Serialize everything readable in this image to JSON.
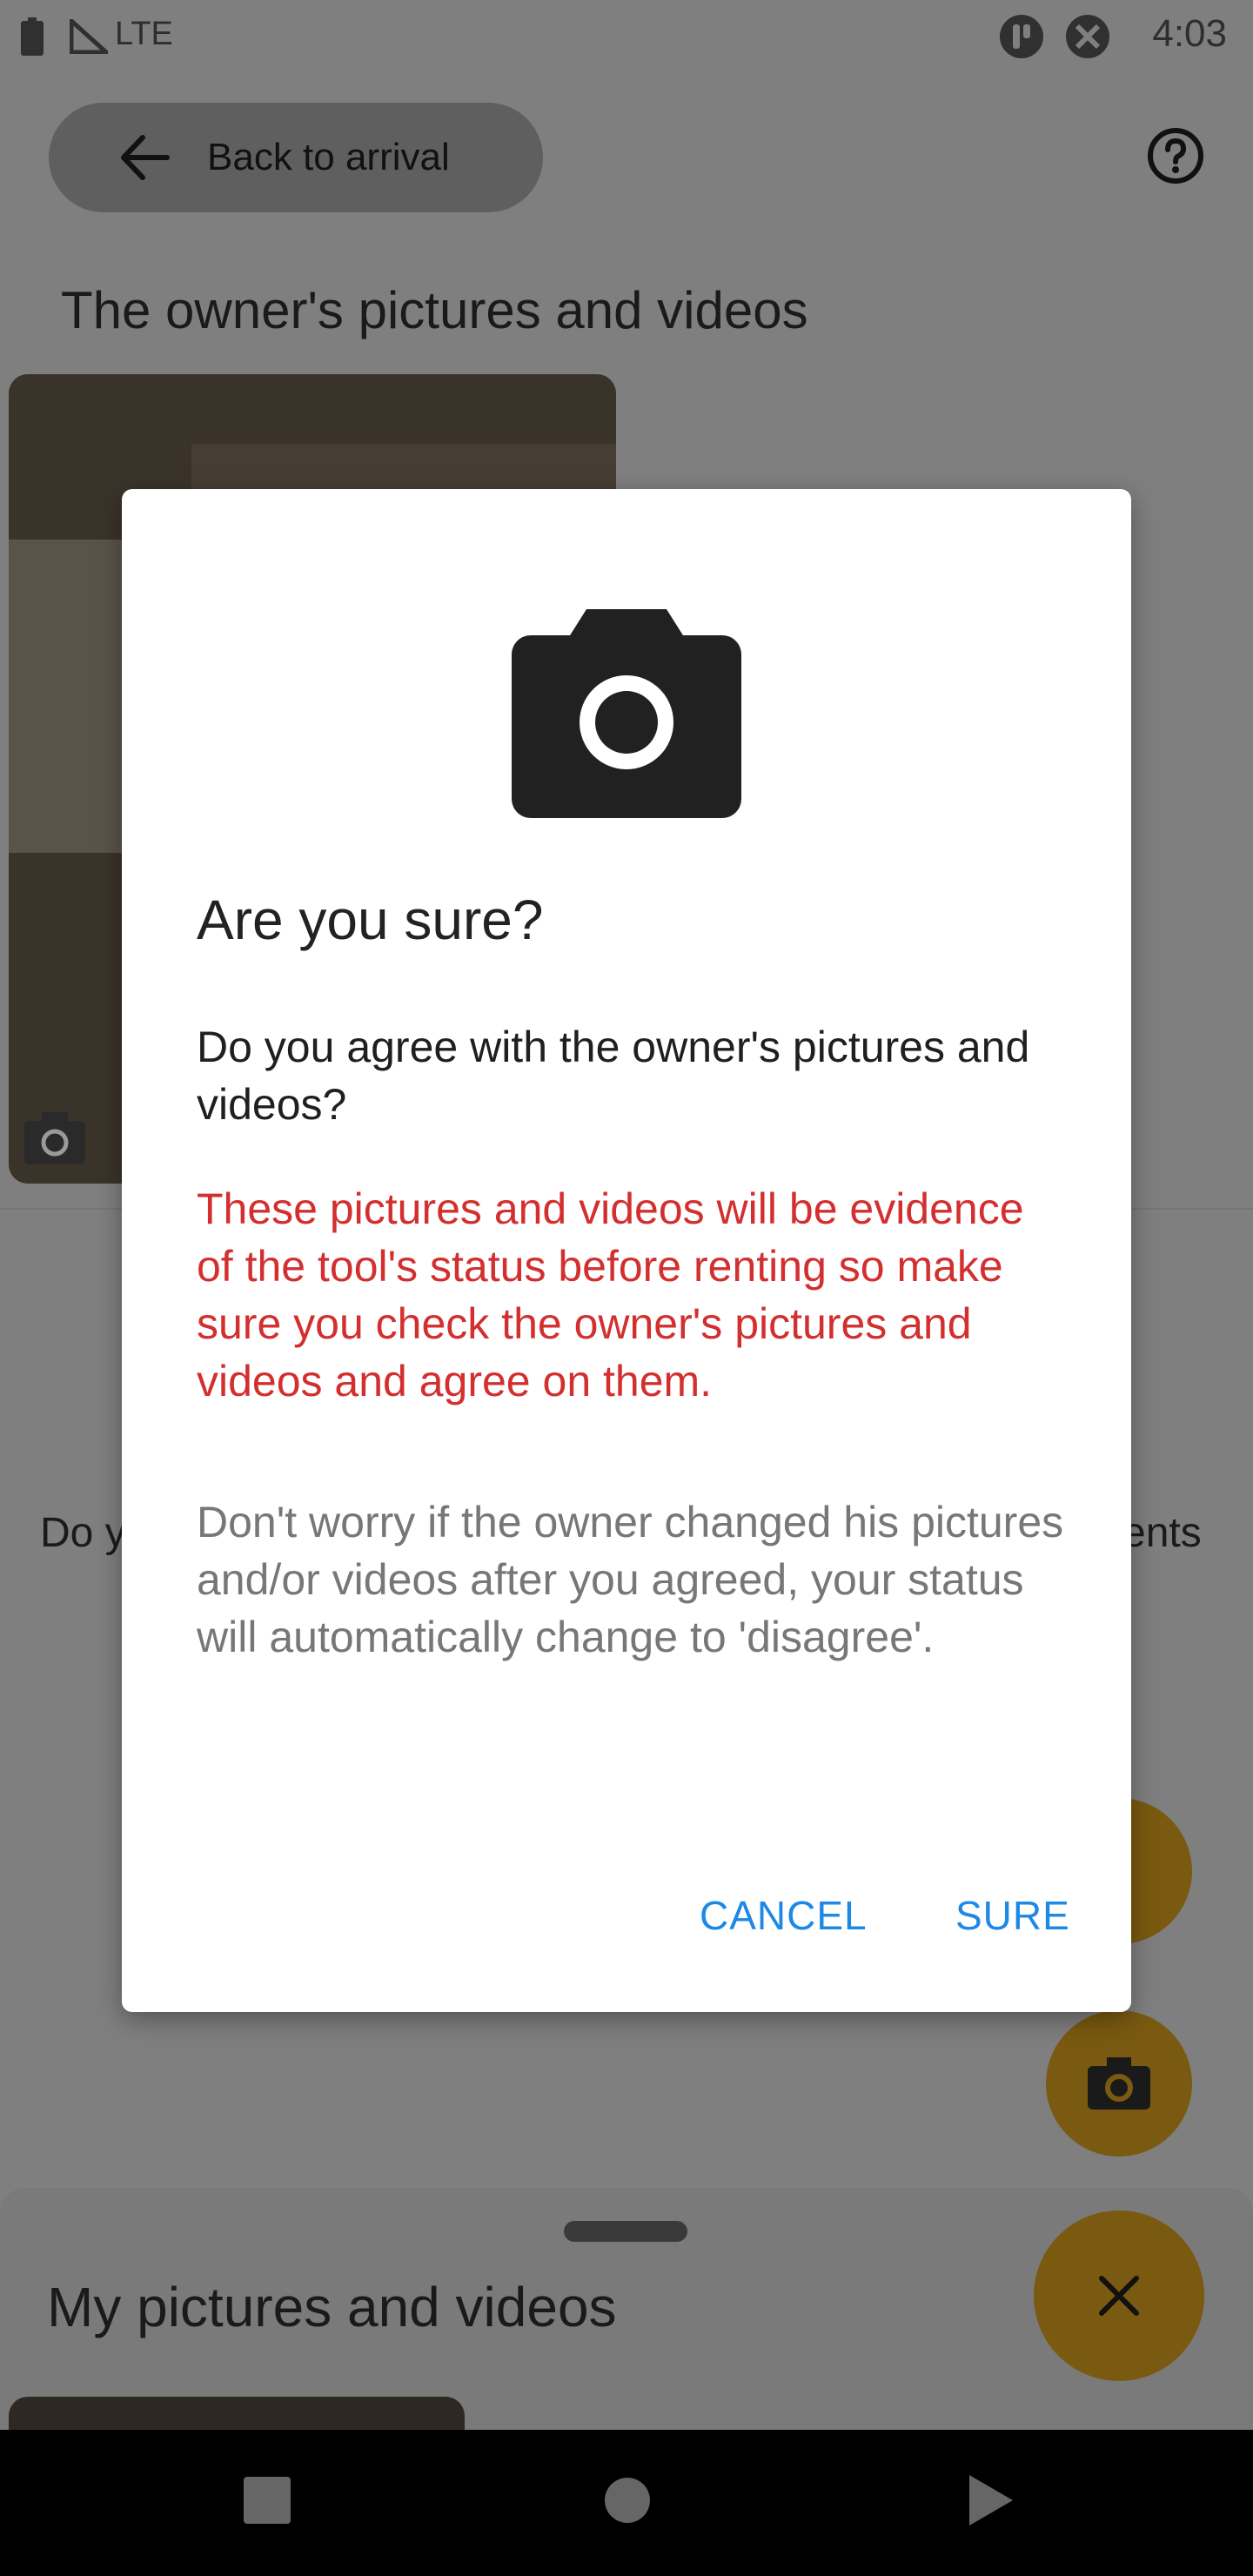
{
  "status_bar": {
    "network": "LTE",
    "time": "4:03"
  },
  "header": {
    "back_label": "Back to arrival"
  },
  "main": {
    "section_title": "The owner's pictures and videos",
    "behind_text_left": "Do y",
    "behind_text_right": "ents"
  },
  "bottom_sheet": {
    "title": "My pictures and videos"
  },
  "dialog": {
    "title": "Are you sure?",
    "message": "Do you agree with the owner's pictures and videos?",
    "warning": "These pictures and videos will be evidence of the tool's status before renting so make sure you check the owner's pictures and videos and agree on them.",
    "note": "Don't worry if the owner changed his pictures and/or videos after you agreed, your status will automatically change to 'disagree'.",
    "cancel_label": "CANCEL",
    "confirm_label": "SURE"
  },
  "colors": {
    "warning": "#d32f2f",
    "button": "#1e88e5",
    "fab": "#f5a623"
  },
  "icons": [
    "battery-icon",
    "signal-icon",
    "app-notification-icon",
    "tools-icon",
    "back-arrow-icon",
    "help-icon",
    "camera-icon",
    "close-icon",
    "nav-recents-icon",
    "nav-home-icon",
    "nav-back-icon"
  ]
}
